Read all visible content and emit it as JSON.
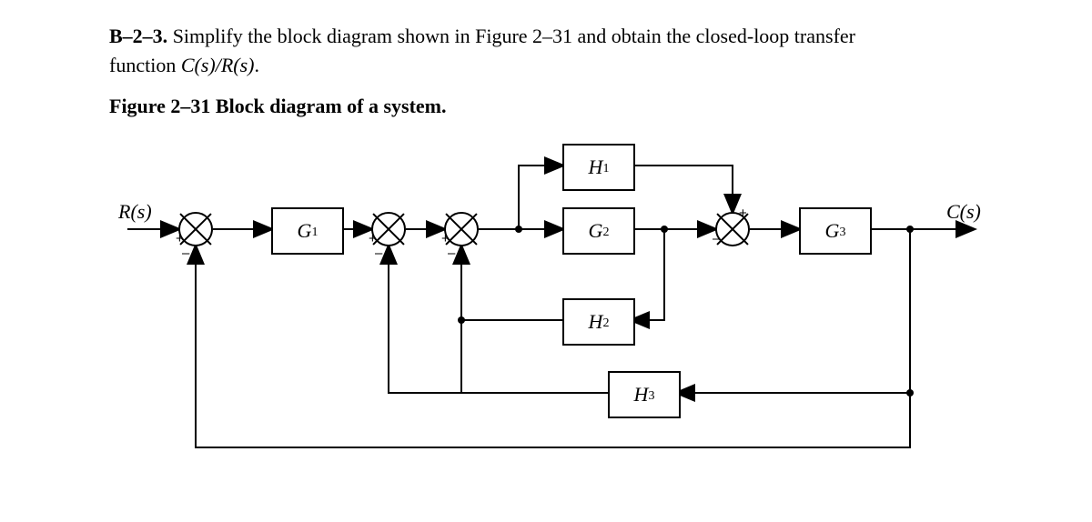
{
  "problem": {
    "id": "B–2–3.",
    "text1": "Simplify the block diagram shown in Figure 2–31 and obtain the closed-loop transfer",
    "text2": "function ",
    "tf": "C(s)/R(s)",
    "period": "."
  },
  "caption": "Figure 2–31 Block diagram of a system.",
  "labels": {
    "input": "R(s)",
    "output": "C(s)",
    "G1": "G",
    "G1sub": "1",
    "G2": "G",
    "G2sub": "2",
    "G3": "G",
    "G3sub": "3",
    "H1": "H",
    "H1sub": "1",
    "H2": "H",
    "H2sub": "2",
    "H3": "H",
    "H3sub": "3"
  },
  "signs": {
    "s1p": "+",
    "s1m": "–",
    "s2p": "+",
    "s2m": "–",
    "s3p": "+",
    "s3m": "–",
    "s4p": "+",
    "s4m": "–"
  }
}
